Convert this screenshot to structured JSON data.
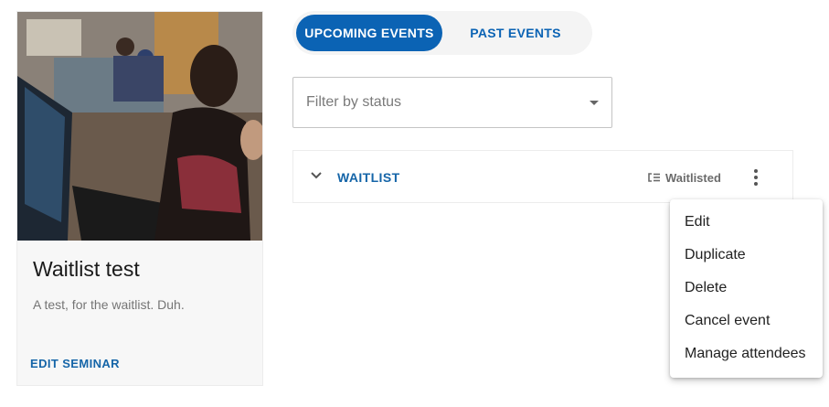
{
  "seminar_card": {
    "title": "Waitlist test",
    "description": "A test, for the waitlist. Duh.",
    "action_label": "EDIT SEMINAR"
  },
  "tabs": [
    {
      "label": "UPCOMING EVENTS",
      "active": true
    },
    {
      "label": "PAST EVENTS",
      "active": false
    }
  ],
  "filter": {
    "placeholder": "Filter by status",
    "icon": "dropdown-arrow-icon"
  },
  "event_row": {
    "name": "WAITLIST",
    "status": "Waitlisted",
    "status_icon": "waitlist-icon",
    "expand_icon": "chevron-down-icon",
    "menu_icon": "more-vertical-icon"
  },
  "context_menu": {
    "items": [
      "Edit",
      "Duplicate",
      "Delete",
      "Cancel event",
      "Manage attendees"
    ]
  },
  "colors": {
    "accent": "#0b63b4",
    "link": "#1565a8",
    "card_background": "#f7f7f7"
  }
}
